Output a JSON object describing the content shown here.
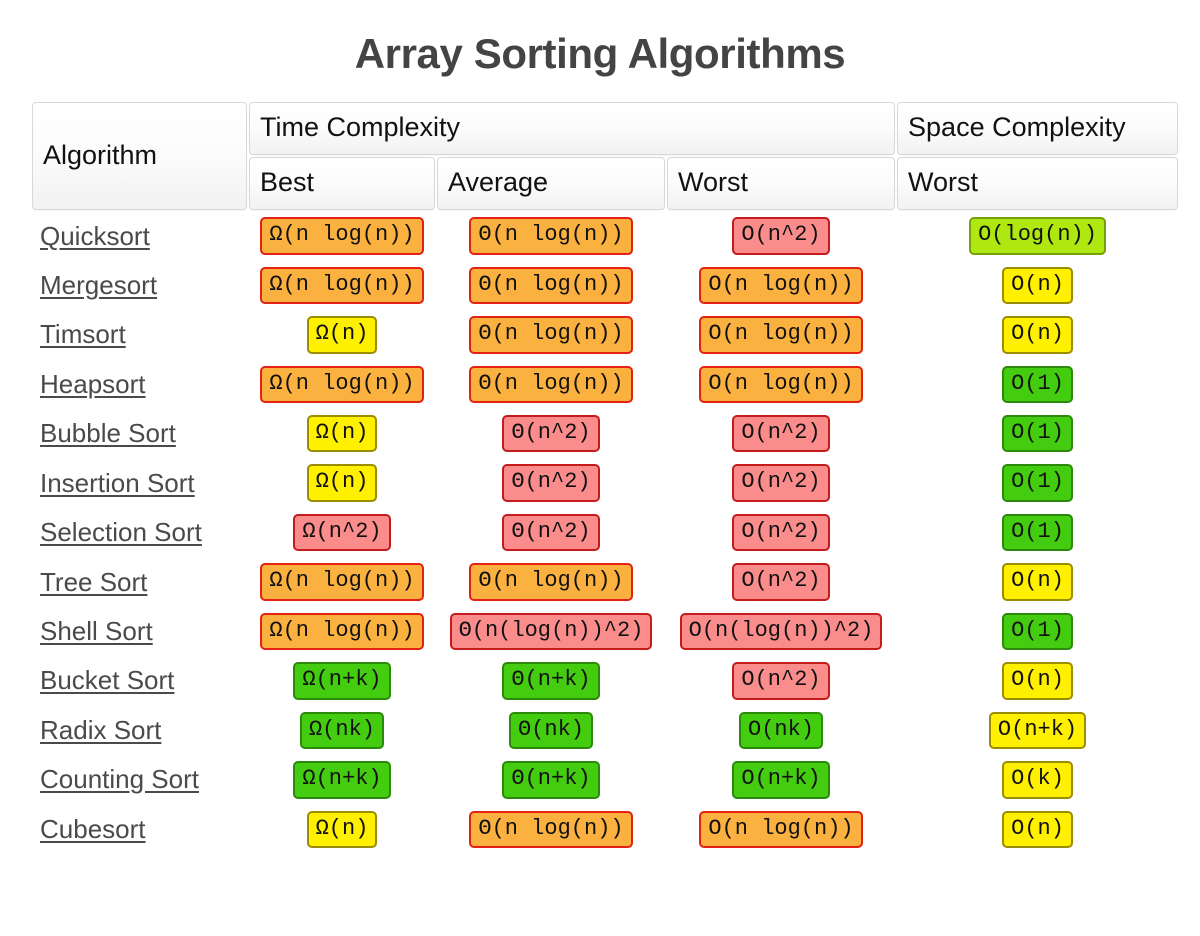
{
  "page": {
    "title": "Array Sorting Algorithms"
  },
  "table": {
    "header_top": {
      "algorithm": "Algorithm",
      "time_complexity": "Time Complexity",
      "space_complexity": "Space Complexity"
    },
    "header_sub": {
      "blank": "",
      "best": "Best",
      "average": "Average",
      "worst": "Worst",
      "space_worst": "Worst"
    },
    "colors": {
      "excellent": "#44cc11",
      "excellent_border": "#2c8a0b",
      "good": "#aee810",
      "good_border": "#78a00a",
      "fair": "#fff000",
      "fair_border": "#9a8d00",
      "bad": "#fbb13f",
      "bad_border": "#e32213",
      "horrible": "#fa8c8c",
      "horrible_border": "#c41c1c",
      "title": "#444444",
      "link": "#4a4a4a"
    },
    "rows": [
      {
        "name": "Quicksort",
        "best": "Ω(n log(n))",
        "best_class": "cx-bad",
        "avg": "Θ(n log(n))",
        "avg_class": "cx-bad",
        "worst": "O(n^2)",
        "worst_class": "cx-horrible",
        "space": "O(log(n))",
        "space_class": "cx-good"
      },
      {
        "name": "Mergesort",
        "best": "Ω(n log(n))",
        "best_class": "cx-bad",
        "avg": "Θ(n log(n))",
        "avg_class": "cx-bad",
        "worst": "O(n log(n))",
        "worst_class": "cx-bad",
        "space": "O(n)",
        "space_class": "cx-fair"
      },
      {
        "name": "Timsort",
        "best": "Ω(n)",
        "best_class": "cx-fair",
        "avg": "Θ(n log(n))",
        "avg_class": "cx-bad",
        "worst": "O(n log(n))",
        "worst_class": "cx-bad",
        "space": "O(n)",
        "space_class": "cx-fair"
      },
      {
        "name": "Heapsort",
        "best": "Ω(n log(n))",
        "best_class": "cx-bad",
        "avg": "Θ(n log(n))",
        "avg_class": "cx-bad",
        "worst": "O(n log(n))",
        "worst_class": "cx-bad",
        "space": "O(1)",
        "space_class": "cx-excellent"
      },
      {
        "name": "Bubble Sort",
        "best": "Ω(n)",
        "best_class": "cx-fair",
        "avg": "Θ(n^2)",
        "avg_class": "cx-horrible",
        "worst": "O(n^2)",
        "worst_class": "cx-horrible",
        "space": "O(1)",
        "space_class": "cx-excellent"
      },
      {
        "name": "Insertion Sort",
        "best": "Ω(n)",
        "best_class": "cx-fair",
        "avg": "Θ(n^2)",
        "avg_class": "cx-horrible",
        "worst": "O(n^2)",
        "worst_class": "cx-horrible",
        "space": "O(1)",
        "space_class": "cx-excellent"
      },
      {
        "name": "Selection Sort",
        "best": "Ω(n^2)",
        "best_class": "cx-horrible",
        "avg": "Θ(n^2)",
        "avg_class": "cx-horrible",
        "worst": "O(n^2)",
        "worst_class": "cx-horrible",
        "space": "O(1)",
        "space_class": "cx-excellent"
      },
      {
        "name": "Tree Sort",
        "best": "Ω(n log(n))",
        "best_class": "cx-bad",
        "avg": "Θ(n log(n))",
        "avg_class": "cx-bad",
        "worst": "O(n^2)",
        "worst_class": "cx-horrible",
        "space": "O(n)",
        "space_class": "cx-fair"
      },
      {
        "name": "Shell Sort",
        "best": "Ω(n log(n))",
        "best_class": "cx-bad",
        "avg": "Θ(n(log(n))^2)",
        "avg_class": "cx-horrible",
        "worst": "O(n(log(n))^2)",
        "worst_class": "cx-horrible",
        "space": "O(1)",
        "space_class": "cx-excellent"
      },
      {
        "name": "Bucket Sort",
        "best": "Ω(n+k)",
        "best_class": "cx-excellent",
        "avg": "Θ(n+k)",
        "avg_class": "cx-excellent",
        "worst": "O(n^2)",
        "worst_class": "cx-horrible",
        "space": "O(n)",
        "space_class": "cx-fair"
      },
      {
        "name": "Radix Sort",
        "best": "Ω(nk)",
        "best_class": "cx-excellent",
        "avg": "Θ(nk)",
        "avg_class": "cx-excellent",
        "worst": "O(nk)",
        "worst_class": "cx-excellent",
        "space": "O(n+k)",
        "space_class": "cx-fair"
      },
      {
        "name": "Counting Sort",
        "best": "Ω(n+k)",
        "best_class": "cx-excellent",
        "avg": "Θ(n+k)",
        "avg_class": "cx-excellent",
        "worst": "O(n+k)",
        "worst_class": "cx-excellent",
        "space": "O(k)",
        "space_class": "cx-fair"
      },
      {
        "name": "Cubesort",
        "best": "Ω(n)",
        "best_class": "cx-fair",
        "avg": "Θ(n log(n))",
        "avg_class": "cx-bad",
        "worst": "O(n log(n))",
        "worst_class": "cx-bad",
        "space": "O(n)",
        "space_class": "cx-fair"
      }
    ]
  }
}
